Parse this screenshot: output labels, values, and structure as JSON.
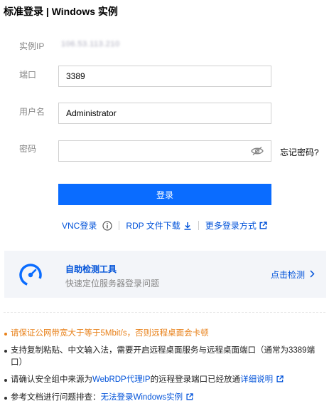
{
  "title": "标准登录 | Windows 实例",
  "form": {
    "ip_label": "实例IP",
    "ip_value": "106.53.113.210",
    "port_label": "端口",
    "port_value": "3389",
    "user_label": "用户名",
    "user_value": "Administrator",
    "password_label": "密码",
    "password_value": "",
    "forgot_label": "忘记密码?",
    "login_label": "登录"
  },
  "links": {
    "vnc": "VNC登录",
    "rdp": "RDP 文件下载",
    "more": "更多登录方式"
  },
  "tool": {
    "title": "自助检测工具",
    "subtitle": "快速定位服务器登录问题",
    "action": "点击检测"
  },
  "notes": {
    "n1": "请保证公网带宽大于等于5Mbit/s，否则远程桌面会卡顿",
    "n2": "支持复制粘贴、中文输入法，需要开启远程桌面服务与远程桌面端口（通常为3389端口）",
    "n3_a": "请确认安全组中来源为",
    "n3_link": "WebRDP代理IP",
    "n3_b": "的远程登录端口已经放通",
    "n3_detail": "详细说明",
    "n4_a": "参考文档进行问题排查：",
    "n4_link": "无法登录Windows实例"
  },
  "colors": {
    "accent": "#0052d9",
    "button": "#0a6cff",
    "warning": "#e8811a"
  }
}
